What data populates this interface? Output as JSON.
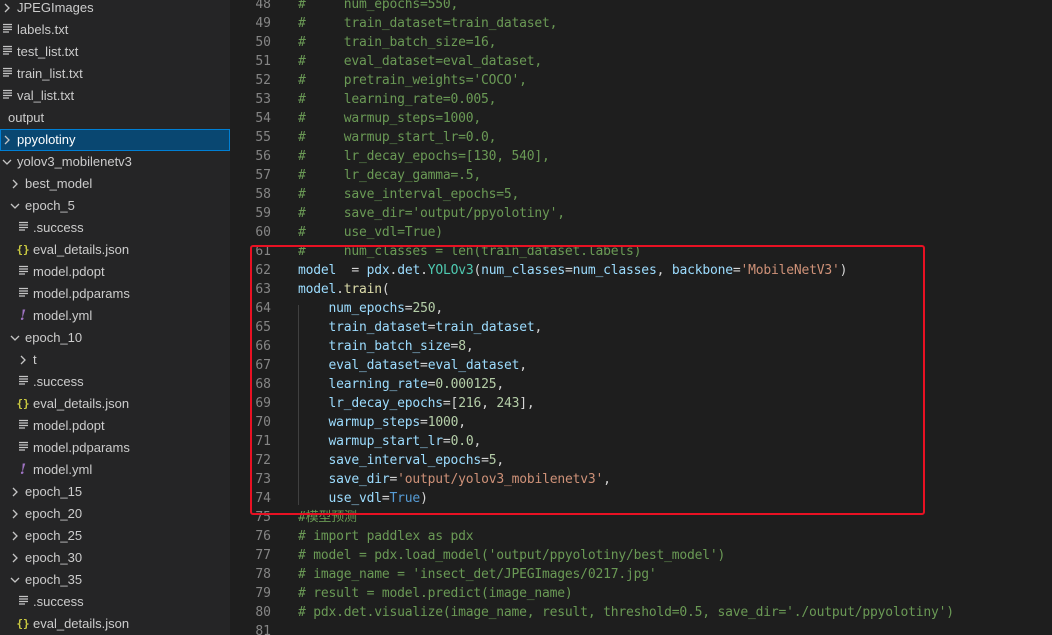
{
  "explorer": {
    "items": [
      {
        "label": "JPEGImages",
        "icon": "chevron-right-icon",
        "indent": 0
      },
      {
        "label": "labels.txt",
        "icon": "text-file-icon",
        "indent": 0
      },
      {
        "label": "test_list.txt",
        "icon": "text-file-icon",
        "indent": 0
      },
      {
        "label": "train_list.txt",
        "icon": "text-file-icon",
        "indent": 0
      },
      {
        "label": "val_list.txt",
        "icon": "text-file-icon",
        "indent": 0
      },
      {
        "label": "output",
        "icon": "chevron-down-icon",
        "indent": -1
      },
      {
        "label": "ppyolotiny",
        "icon": "chevron-right-icon",
        "indent": 0,
        "selected": true
      },
      {
        "label": "yolov3_mobilenetv3",
        "icon": "chevron-down-icon",
        "indent": 0
      },
      {
        "label": "best_model",
        "icon": "chevron-right-icon",
        "indent": 1
      },
      {
        "label": "epoch_5",
        "icon": "chevron-down-icon",
        "indent": 1
      },
      {
        "label": ".success",
        "icon": "text-file-icon",
        "indent": 2
      },
      {
        "label": "eval_details.json",
        "icon": "json-file-icon",
        "indent": 2
      },
      {
        "label": "model.pdopt",
        "icon": "text-file-icon",
        "indent": 2
      },
      {
        "label": "model.pdparams",
        "icon": "text-file-icon",
        "indent": 2
      },
      {
        "label": "model.yml",
        "icon": "yaml-file-icon",
        "indent": 2
      },
      {
        "label": "epoch_10",
        "icon": "chevron-down-icon",
        "indent": 1
      },
      {
        "label": "t",
        "icon": "chevron-right-icon",
        "indent": 2
      },
      {
        "label": ".success",
        "icon": "text-file-icon",
        "indent": 2
      },
      {
        "label": "eval_details.json",
        "icon": "json-file-icon",
        "indent": 2
      },
      {
        "label": "model.pdopt",
        "icon": "text-file-icon",
        "indent": 2
      },
      {
        "label": "model.pdparams",
        "icon": "text-file-icon",
        "indent": 2
      },
      {
        "label": "model.yml",
        "icon": "yaml-file-icon",
        "indent": 2
      },
      {
        "label": "epoch_15",
        "icon": "chevron-right-icon",
        "indent": 1
      },
      {
        "label": "epoch_20",
        "icon": "chevron-right-icon",
        "indent": 1
      },
      {
        "label": "epoch_25",
        "icon": "chevron-right-icon",
        "indent": 1
      },
      {
        "label": "epoch_30",
        "icon": "chevron-right-icon",
        "indent": 1
      },
      {
        "label": "epoch_35",
        "icon": "chevron-down-icon",
        "indent": 1
      },
      {
        "label": ".success",
        "icon": "text-file-icon",
        "indent": 2
      },
      {
        "label": "eval_details.json",
        "icon": "json-file-icon",
        "indent": 2
      }
    ]
  },
  "editor": {
    "lines": [
      {
        "n": "48",
        "t": [
          [
            "cm",
            "#     num_epochs=550,"
          ]
        ]
      },
      {
        "n": "49",
        "t": [
          [
            "cm",
            "#     train_dataset=train_dataset,"
          ]
        ]
      },
      {
        "n": "50",
        "t": [
          [
            "cm",
            "#     train_batch_size=16,"
          ]
        ]
      },
      {
        "n": "51",
        "t": [
          [
            "cm",
            "#     eval_dataset=eval_dataset,"
          ]
        ]
      },
      {
        "n": "52",
        "t": [
          [
            "cm",
            "#     pretrain_weights='COCO',"
          ]
        ]
      },
      {
        "n": "53",
        "t": [
          [
            "cm",
            "#     learning_rate=0.005,"
          ]
        ]
      },
      {
        "n": "54",
        "t": [
          [
            "cm",
            "#     warmup_steps=1000,"
          ]
        ]
      },
      {
        "n": "55",
        "t": [
          [
            "cm",
            "#     warmup_start_lr=0.0,"
          ]
        ]
      },
      {
        "n": "56",
        "t": [
          [
            "cm",
            "#     lr_decay_epochs=[130, 540],"
          ]
        ]
      },
      {
        "n": "57",
        "t": [
          [
            "cm",
            "#     lr_decay_gamma=.5,"
          ]
        ]
      },
      {
        "n": "58",
        "t": [
          [
            "cm",
            "#     save_interval_epochs=5,"
          ]
        ]
      },
      {
        "n": "59",
        "t": [
          [
            "cm",
            "#     save_dir='output/ppyolotiny',"
          ]
        ]
      },
      {
        "n": "60",
        "t": [
          [
            "cm",
            "#     use_vdl=True)"
          ]
        ]
      },
      {
        "n": "61",
        "t": [
          [
            "cm",
            "#     num_classes = len(train_dataset.labels)"
          ]
        ]
      },
      {
        "n": "62",
        "t": [
          [
            "vr",
            "model"
          ],
          [
            "",
            "  = "
          ],
          [
            "vr",
            "pdx"
          ],
          [
            "",
            "."
          ],
          [
            "vr",
            "det"
          ],
          [
            "",
            "."
          ],
          [
            "cl",
            "YOLOv3"
          ],
          [
            "",
            "("
          ],
          [
            "vr",
            "num_classes"
          ],
          [
            "",
            "="
          ],
          [
            "vr",
            "num_classes"
          ],
          [
            "",
            ", "
          ],
          [
            "vr",
            "backbone"
          ],
          [
            "",
            "="
          ],
          [
            "st",
            "'MobileNetV3'"
          ],
          [
            "",
            ")"
          ]
        ]
      },
      {
        "n": "63",
        "t": [
          [
            "vr",
            "model"
          ],
          [
            "",
            "."
          ],
          [
            "fn",
            "train"
          ],
          [
            "",
            "("
          ]
        ]
      },
      {
        "n": "64",
        "t": [
          [
            "",
            "    "
          ],
          [
            "vr",
            "num_epochs"
          ],
          [
            "",
            "="
          ],
          [
            "nm",
            "250"
          ],
          [
            "",
            ","
          ]
        ]
      },
      {
        "n": "65",
        "t": [
          [
            "",
            "    "
          ],
          [
            "vr",
            "train_dataset"
          ],
          [
            "",
            "="
          ],
          [
            "vr",
            "train_dataset"
          ],
          [
            "",
            ","
          ]
        ]
      },
      {
        "n": "66",
        "t": [
          [
            "",
            "    "
          ],
          [
            "vr",
            "train_batch_size"
          ],
          [
            "",
            "="
          ],
          [
            "nm",
            "8"
          ],
          [
            "",
            ","
          ]
        ]
      },
      {
        "n": "67",
        "t": [
          [
            "",
            "    "
          ],
          [
            "vr",
            "eval_dataset"
          ],
          [
            "",
            "="
          ],
          [
            "vr",
            "eval_dataset"
          ],
          [
            "",
            ","
          ]
        ]
      },
      {
        "n": "68",
        "t": [
          [
            "",
            "    "
          ],
          [
            "vr",
            "learning_rate"
          ],
          [
            "",
            "="
          ],
          [
            "nm",
            "0.000125"
          ],
          [
            "",
            ","
          ]
        ]
      },
      {
        "n": "69",
        "t": [
          [
            "",
            "    "
          ],
          [
            "vr",
            "lr_decay_epochs"
          ],
          [
            "",
            "=["
          ],
          [
            "nm",
            "216"
          ],
          [
            "",
            ", "
          ],
          [
            "nm",
            "243"
          ],
          [
            "",
            "],"
          ]
        ]
      },
      {
        "n": "70",
        "t": [
          [
            "",
            "    "
          ],
          [
            "vr",
            "warmup_steps"
          ],
          [
            "",
            "="
          ],
          [
            "nm",
            "1000"
          ],
          [
            "",
            ","
          ]
        ]
      },
      {
        "n": "71",
        "t": [
          [
            "",
            "    "
          ],
          [
            "vr",
            "warmup_start_lr"
          ],
          [
            "",
            "="
          ],
          [
            "nm",
            "0.0"
          ],
          [
            "",
            ","
          ]
        ]
      },
      {
        "n": "72",
        "t": [
          [
            "",
            "    "
          ],
          [
            "vr",
            "save_interval_epochs"
          ],
          [
            "",
            "="
          ],
          [
            "nm",
            "5"
          ],
          [
            "",
            ","
          ]
        ]
      },
      {
        "n": "73",
        "t": [
          [
            "",
            "    "
          ],
          [
            "vr",
            "save_dir"
          ],
          [
            "",
            "="
          ],
          [
            "st",
            "'output/yolov3_mobilenetv3'"
          ],
          [
            "",
            ","
          ]
        ]
      },
      {
        "n": "74",
        "t": [
          [
            "",
            "    "
          ],
          [
            "vr",
            "use_vdl"
          ],
          [
            "",
            "="
          ],
          [
            "kw",
            "True"
          ],
          [
            "",
            ")"
          ]
        ]
      },
      {
        "n": "75",
        "t": [
          [
            "cm",
            "#模型预测"
          ]
        ]
      },
      {
        "n": "76",
        "t": [
          [
            "cm",
            "# import paddlex as pdx"
          ]
        ]
      },
      {
        "n": "77",
        "t": [
          [
            "cm",
            "# model = pdx.load_model('output/ppyolotiny/best_model')"
          ]
        ]
      },
      {
        "n": "78",
        "t": [
          [
            "cm",
            "# image_name = 'insect_det/JPEGImages/0217.jpg'"
          ]
        ]
      },
      {
        "n": "79",
        "t": [
          [
            "cm",
            "# result = model.predict(image_name)"
          ]
        ]
      },
      {
        "n": "80",
        "t": [
          [
            "cm",
            "# pdx.det.visualize(image_name, result, threshold=0.5, save_dir='./output/ppyolotiny')"
          ]
        ]
      },
      {
        "n": "81",
        "t": [
          [
            "",
            ""
          ]
        ]
      }
    ]
  },
  "colors": {
    "highlight_box": "#e81123",
    "selection": "#094771",
    "comment": "#6a9955",
    "string": "#ce9178",
    "number": "#b5cea8"
  }
}
